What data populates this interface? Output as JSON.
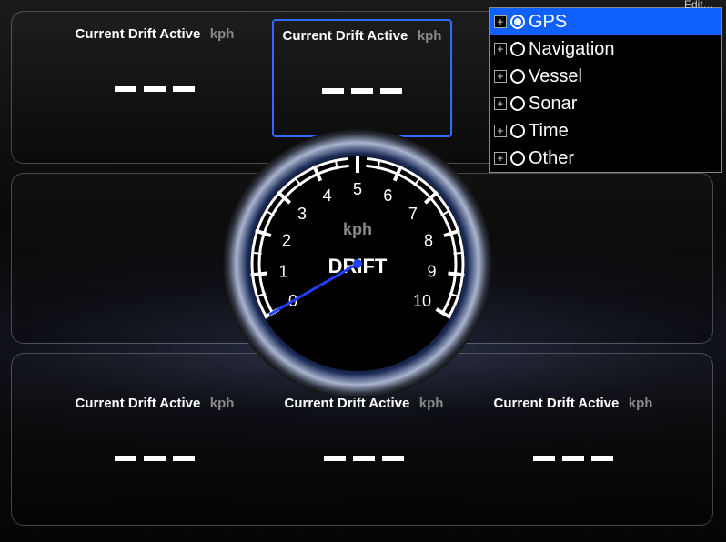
{
  "panels": {
    "top": {
      "drift_boxes": [
        {
          "title": "Current Drift Active",
          "unit": "kph",
          "value": "— — —",
          "selected": false
        },
        {
          "title": "Current Drift Active",
          "unit": "kph",
          "value": "— — —",
          "selected": true
        }
      ]
    },
    "bottom": {
      "drift_boxes": [
        {
          "title": "Current Drift Active",
          "unit": "kph",
          "value": "— — —",
          "selected": false
        },
        {
          "title": "Current Drift Active",
          "unit": "kph",
          "value": "— — —",
          "selected": false
        },
        {
          "title": "Current Drift Active",
          "unit": "kph",
          "value": "— — —",
          "selected": false
        }
      ]
    }
  },
  "gauge": {
    "unit": "kph",
    "label": "DRIFT",
    "min": 0,
    "max": 10,
    "ticks": [
      "0",
      "1",
      "2",
      "3",
      "4",
      "5",
      "6",
      "7",
      "8",
      "9",
      "10"
    ],
    "needle_value": 0,
    "needle_color": "#2040ff"
  },
  "tree": {
    "items": [
      {
        "label": "GPS",
        "selected": true,
        "radio_filled": true
      },
      {
        "label": "Navigation",
        "selected": false,
        "radio_filled": false
      },
      {
        "label": "Vessel",
        "selected": false,
        "radio_filled": false
      },
      {
        "label": "Sonar",
        "selected": false,
        "radio_filled": false
      },
      {
        "label": "Time",
        "selected": false,
        "radio_filled": false
      },
      {
        "label": "Other",
        "selected": false,
        "radio_filled": false
      }
    ]
  },
  "edit_button": "Edit…",
  "chart_data": {
    "type": "gauge",
    "title": "DRIFT",
    "unit": "kph",
    "range": [
      0,
      10
    ],
    "ticks": [
      0,
      1,
      2,
      3,
      4,
      5,
      6,
      7,
      8,
      9,
      10
    ],
    "value": 0
  }
}
